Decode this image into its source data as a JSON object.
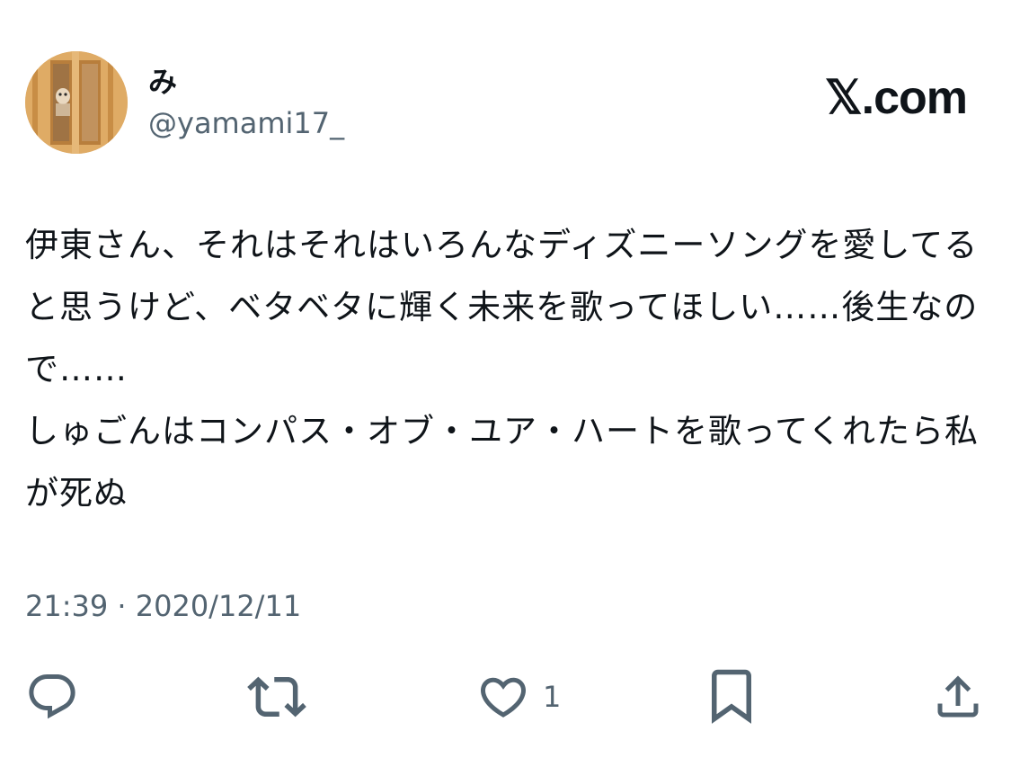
{
  "user": {
    "display_name": "み",
    "handle": "@yamami17_"
  },
  "brand": {
    "text": "𝕏.com"
  },
  "tweet": {
    "text": "伊東さん、それはそれはいろんなディズニーソングを愛してると思うけど、ベタベタに輝く未来を歌ってほしい……後生なので……\nしゅごんはコンパス・オブ・ユア・ハートを歌ってくれたら私が死ぬ",
    "timestamp": "21:39 · 2020/12/11"
  },
  "actions": {
    "reply_icon": "reply-icon",
    "retweet_icon": "retweet-icon",
    "like_icon": "heart-icon",
    "like_count": "1",
    "bookmark_icon": "bookmark-icon",
    "share_icon": "share-icon"
  },
  "colors": {
    "text": "#0f1419",
    "secondary": "#536471"
  }
}
